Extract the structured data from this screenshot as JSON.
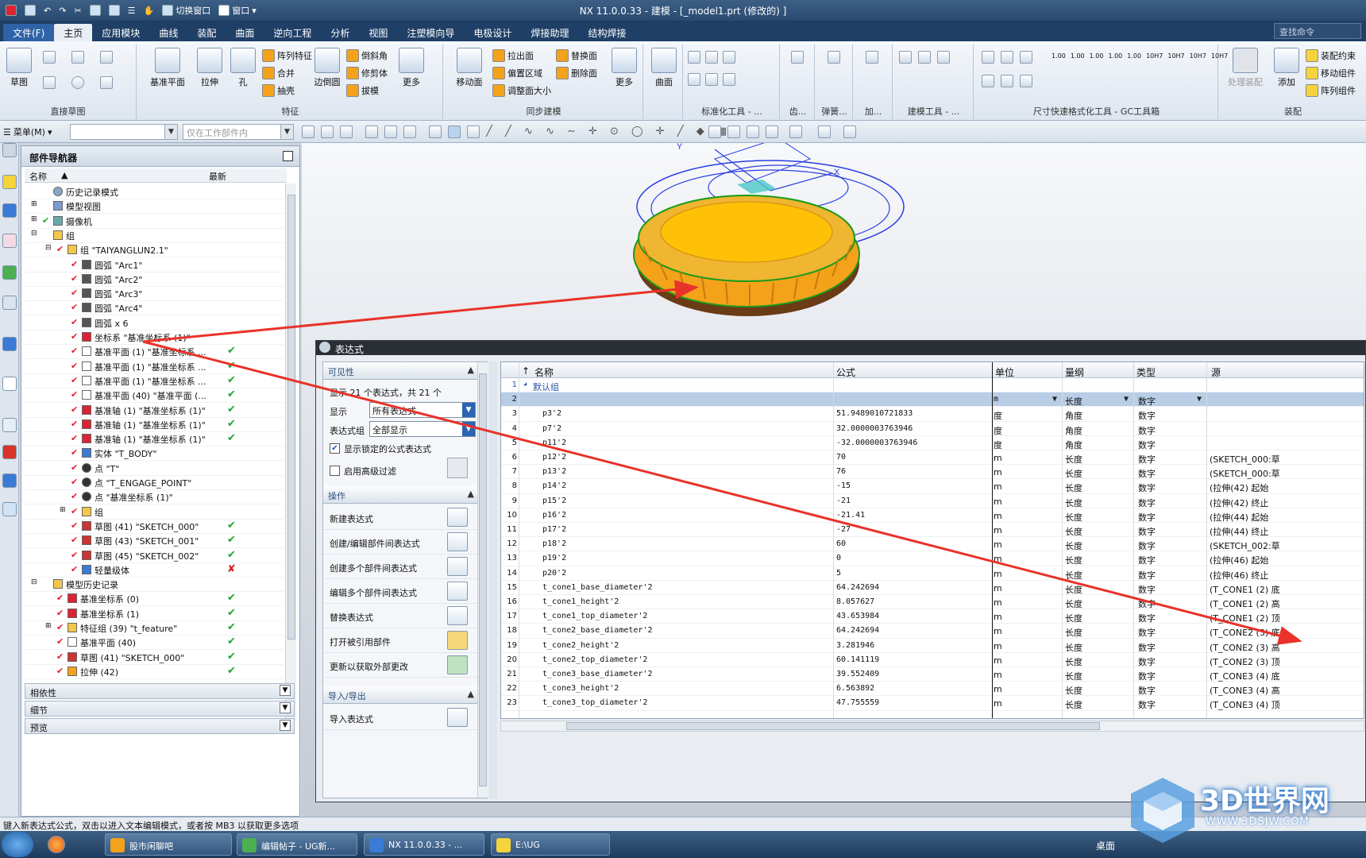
{
  "window": {
    "title": "NX 11.0.0.33 - 建模 - [_model1.prt  (修改的) ]"
  },
  "quick_access": {
    "switch_window": "切换窗口",
    "window": "窗口"
  },
  "tabs": [
    "文件(F)",
    "主页",
    "应用模块",
    "曲线",
    "装配",
    "曲面",
    "逆向工程",
    "分析",
    "视图",
    "注塑模向导",
    "电极设计",
    "焊接助理",
    "结构焊接"
  ],
  "active_tab": "主页",
  "search_command": "查找命令",
  "ribbon": {
    "sketch": "草图",
    "direct_sketch": "直接草图",
    "datum_plane": "基准平面",
    "extrude": "拉伸",
    "hole": "孔",
    "pattern_feature": "阵列特征",
    "unite": "合并",
    "shell": "抽壳",
    "feature": "特征",
    "edge_blend": "边倒圆",
    "chamfer": "倒斜角",
    "trim_body": "修剪体",
    "draft": "拔模",
    "more": "更多",
    "move_face": "移动面",
    "pull_face": "拉出面",
    "offset_region": "偏置区域",
    "resize": "调整面大小",
    "replace_face": "替换面",
    "delete_face": "删除面",
    "sync_modeling": "同步建模",
    "surface": "曲面",
    "standard_tools": "标准化工具 - ...",
    "gear": "齿...",
    "spring": "弹簧...",
    "add": "加...",
    "modeling_tools": "建模工具 - ...",
    "dimension_tools": "尺寸快速格式化工具 - GC工具箱",
    "process_assembly": "处理装配",
    "add_comp": "添加",
    "assembly_constraints": "装配约束",
    "move_component": "移动组件",
    "pattern_component": "阵列组件",
    "assembly": "装配",
    "dim_labels": [
      "1.00",
      "1.00",
      "1.00",
      "1.00",
      "1.00",
      "10H7",
      "10H7",
      "10H7",
      "10H7"
    ]
  },
  "toolbar2": {
    "menu": "菜单(M)",
    "scope": "仅在工作部件内"
  },
  "navigator": {
    "title": "部件导航器",
    "col_name": "名称",
    "col_latest": "最新",
    "rows": [
      {
        "indent": 0,
        "label": "历史记录模式",
        "latest": "",
        "icon": "clock"
      },
      {
        "indent": 0,
        "label": "模型视图",
        "latest": "",
        "icon": "view",
        "expand": "+"
      },
      {
        "indent": 0,
        "label": "摄像机",
        "latest": "",
        "icon": "camera",
        "expand": "+"
      },
      {
        "indent": 0,
        "label": "组",
        "latest": "",
        "icon": "folder",
        "expand": "-"
      },
      {
        "indent": 1,
        "label": "组 \"TAIYANGLUN2.1\"",
        "latest": "",
        "icon": "folder",
        "expand": "-"
      },
      {
        "indent": 2,
        "label": "圆弧 \"Arc1\"",
        "latest": "",
        "icon": "arc"
      },
      {
        "indent": 2,
        "label": "圆弧 \"Arc2\"",
        "latest": "",
        "icon": "arc"
      },
      {
        "indent": 2,
        "label": "圆弧 \"Arc3\"",
        "latest": "",
        "icon": "arc"
      },
      {
        "indent": 2,
        "label": "圆弧 \"Arc4\"",
        "latest": "",
        "icon": "arc"
      },
      {
        "indent": 2,
        "label": "圆弧 x 6",
        "latest": "",
        "icon": "arc"
      },
      {
        "indent": 2,
        "label": "坐标系 \"基准坐标系 (1)\"",
        "latest": "",
        "icon": "csys"
      },
      {
        "indent": 2,
        "label": "基准平面 (1) \"基准坐标系 ...",
        "latest": "ok",
        "icon": "plane"
      },
      {
        "indent": 2,
        "label": "基准平面 (1) \"基准坐标系 ...",
        "latest": "ok",
        "icon": "plane"
      },
      {
        "indent": 2,
        "label": "基准平面 (1) \"基准坐标系 ...",
        "latest": "ok",
        "icon": "plane"
      },
      {
        "indent": 2,
        "label": "基准平面 (40) \"基准平面 (...",
        "latest": "ok",
        "icon": "plane"
      },
      {
        "indent": 2,
        "label": "基准轴 (1) \"基准坐标系 (1)\"",
        "latest": "ok",
        "icon": "axis"
      },
      {
        "indent": 2,
        "label": "基准轴 (1) \"基准坐标系 (1)\"",
        "latest": "ok",
        "icon": "axis"
      },
      {
        "indent": 2,
        "label": "基准轴 (1) \"基准坐标系 (1)\"",
        "latest": "ok",
        "icon": "axis"
      },
      {
        "indent": 2,
        "label": "实体 \"T_BODY\"",
        "latest": "",
        "icon": "solid"
      },
      {
        "indent": 2,
        "label": "点 \"T\"",
        "latest": "",
        "icon": "point"
      },
      {
        "indent": 2,
        "label": "点 \"T_ENGAGE_POINT\"",
        "latest": "",
        "icon": "point"
      },
      {
        "indent": 2,
        "label": "点 \"基准坐标系 (1)\"",
        "latest": "",
        "icon": "point"
      },
      {
        "indent": 2,
        "label": "组",
        "latest": "",
        "icon": "folder",
        "expand": "+"
      },
      {
        "indent": 2,
        "label": "草图 (41) \"SKETCH_000\"",
        "latest": "ok",
        "icon": "sketch"
      },
      {
        "indent": 2,
        "label": "草图 (43) \"SKETCH_001\"",
        "latest": "ok",
        "icon": "sketch"
      },
      {
        "indent": 2,
        "label": "草图 (45) \"SKETCH_002\"",
        "latest": "ok",
        "icon": "sketch"
      },
      {
        "indent": 2,
        "label": "轻量级体",
        "latest": "bad",
        "icon": "solid"
      },
      {
        "indent": 0,
        "label": "模型历史记录",
        "latest": "",
        "icon": "folder",
        "expand": "-"
      },
      {
        "indent": 1,
        "label": "基准坐标系 (0)",
        "latest": "ok",
        "icon": "csys"
      },
      {
        "indent": 1,
        "label": "基准坐标系 (1)",
        "latest": "ok",
        "icon": "csys"
      },
      {
        "indent": 1,
        "label": "特征组 (39) \"t_feature\"",
        "latest": "ok",
        "icon": "folder",
        "expand": "+"
      },
      {
        "indent": 1,
        "label": "基准平面 (40)",
        "latest": "ok",
        "icon": "plane"
      },
      {
        "indent": 1,
        "label": "草图 (41) \"SKETCH_000\"",
        "latest": "ok",
        "icon": "sketch"
      },
      {
        "indent": 1,
        "label": "拉伸 (42)",
        "latest": "ok",
        "icon": "extrude"
      }
    ],
    "sections": [
      "相依性",
      "细节",
      "预览"
    ]
  },
  "expressions": {
    "title": "表达式",
    "visibility": "可见性",
    "showing": "显示 21 个表达式，共 21 个",
    "show_label": "显示",
    "show_value": "所有表达式",
    "group_label": "表达式组",
    "group_value": "全部显示",
    "show_locked": "显示锁定的公式表达式",
    "advanced_filter": "启用高级过滤",
    "operations": "操作",
    "ops": [
      "新建表达式",
      "创建/编辑部件间表达式",
      "创建多个部件间表达式",
      "编辑多个部件间表达式",
      "替换表达式",
      "打开被引用部件",
      "更新以获取外部更改"
    ],
    "import_export": "导入/导出",
    "import": "导入表达式",
    "columns": {
      "name": "名称",
      "formula": "公式",
      "unit": "单位",
      "dimensionality": "量纲",
      "type": "类型",
      "source": "源"
    },
    "default_group": "默认组",
    "row2": {
      "unit": "m",
      "dim": "长度",
      "type": "数字"
    },
    "rows": [
      {
        "n": "3",
        "name": "p3'2",
        "formula": "51.9489010721833",
        "unit": "度",
        "dim": "角度",
        "type": "数字",
        "src": ""
      },
      {
        "n": "4",
        "name": "p7'2",
        "formula": "32.0000003763946",
        "unit": "度",
        "dim": "角度",
        "type": "数字",
        "src": ""
      },
      {
        "n": "5",
        "name": "p11'2",
        "formula": "-32.0000003763946",
        "unit": "度",
        "dim": "角度",
        "type": "数字",
        "src": ""
      },
      {
        "n": "6",
        "name": "p12'2",
        "formula": "70",
        "unit": "m",
        "dim": "长度",
        "type": "数字",
        "src": "(SKETCH_000:草"
      },
      {
        "n": "7",
        "name": "p13'2",
        "formula": "76",
        "unit": "m",
        "dim": "长度",
        "type": "数字",
        "src": "(SKETCH_000:草"
      },
      {
        "n": "8",
        "name": "p14'2",
        "formula": "-15",
        "unit": "m",
        "dim": "长度",
        "type": "数字",
        "src": "(拉伸(42) 起始"
      },
      {
        "n": "9",
        "name": "p15'2",
        "formula": "-21",
        "unit": "m",
        "dim": "长度",
        "type": "数字",
        "src": "(拉伸(42) 终止"
      },
      {
        "n": "10",
        "name": "p16'2",
        "formula": "-21.41",
        "unit": "m",
        "dim": "长度",
        "type": "数字",
        "src": "(拉伸(44) 起始"
      },
      {
        "n": "11",
        "name": "p17'2",
        "formula": "-27",
        "unit": "m",
        "dim": "长度",
        "type": "数字",
        "src": "(拉伸(44) 终止"
      },
      {
        "n": "12",
        "name": "p18'2",
        "formula": "60",
        "unit": "m",
        "dim": "长度",
        "type": "数字",
        "src": "(SKETCH_002:草"
      },
      {
        "n": "13",
        "name": "p19'2",
        "formula": "0",
        "unit": "m",
        "dim": "长度",
        "type": "数字",
        "src": "(拉伸(46) 起始"
      },
      {
        "n": "14",
        "name": "p20'2",
        "formula": "5",
        "unit": "m",
        "dim": "长度",
        "type": "数字",
        "src": "(拉伸(46) 终止"
      },
      {
        "n": "15",
        "name": "t_cone1_base_diameter'2",
        "formula": "64.242694",
        "unit": "m",
        "dim": "长度",
        "type": "数字",
        "src": "(T_CONE1 (2) 底"
      },
      {
        "n": "16",
        "name": "t_cone1_height'2",
        "formula": "8.057627",
        "unit": "m",
        "dim": "长度",
        "type": "数字",
        "src": "(T_CONE1 (2) 高"
      },
      {
        "n": "17",
        "name": "t_cone1_top_diameter'2",
        "formula": "43.653984",
        "unit": "m",
        "dim": "长度",
        "type": "数字",
        "src": "(T_CONE1 (2) 顶"
      },
      {
        "n": "18",
        "name": "t_cone2_base_diameter'2",
        "formula": "64.242694",
        "unit": "m",
        "dim": "长度",
        "type": "数字",
        "src": "(T_CONE2 (3) 底"
      },
      {
        "n": "19",
        "name": "t_cone2_height'2",
        "formula": "3.281946",
        "unit": "m",
        "dim": "长度",
        "type": "数字",
        "src": "(T_CONE2 (3) 高"
      },
      {
        "n": "20",
        "name": "t_cone2_top_diameter'2",
        "formula": "60.141119",
        "unit": "m",
        "dim": "长度",
        "type": "数字",
        "src": "(T_CONE2 (3) 顶"
      },
      {
        "n": "21",
        "name": "t_cone3_base_diameter'2",
        "formula": "39.552409",
        "unit": "m",
        "dim": "长度",
        "type": "数字",
        "src": "(T_CONE3 (4) 底"
      },
      {
        "n": "22",
        "name": "t_cone3_height'2",
        "formula": "6.563892",
        "unit": "m",
        "dim": "长度",
        "type": "数字",
        "src": "(T_CONE3 (4) 高"
      },
      {
        "n": "23",
        "name": "t_cone3_top_diameter'2",
        "formula": "47.755559",
        "unit": "m",
        "dim": "长度",
        "type": "数字",
        "src": "(T_CONE3 (4) 顶"
      }
    ]
  },
  "status": "键入新表达式公式，双击以进入文本编辑模式，或者按 MB3 以获取更多选项",
  "taskbar": {
    "items": [
      "股市闲聊吧",
      "编辑帖子 - UG新...",
      "NX 11.0.0.33 - ...",
      "E:\\UG"
    ],
    "desktop": "桌面"
  },
  "watermark": {
    "text": "3D世界网",
    "url": "WWW.3DSJW.COM"
  },
  "colors": {
    "ribbon_tab_bg": "#1f3f66",
    "accent": "#2a64b4",
    "arrow": "#e8322a",
    "ok_check": "#1aa82c",
    "model_orange": "#f4a21a"
  }
}
